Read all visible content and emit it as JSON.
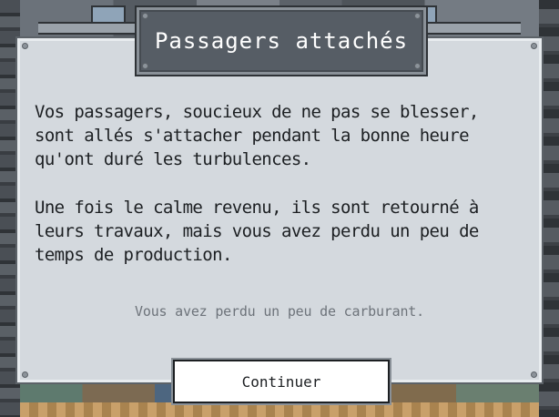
{
  "dialog": {
    "title": "Passagers attachés",
    "paragraphs": [
      "Vos passagers, soucieux de ne pas se blesser, sont allés s'attacher pendant la bonne heure qu'ont duré les turbulences.",
      "Une fois le calme revenu, ils sont retourné à leurs travaux, mais vous avez perdu un peu de temps de production."
    ],
    "note": "Vous avez perdu un peu de carburant.",
    "continue_label": "Continuer"
  },
  "colors": {
    "panel": "#d4d9de",
    "title_plate": "#565d65",
    "body_text": "#1c1f22",
    "note_text": "#6d737a",
    "button": "#ffffff"
  }
}
